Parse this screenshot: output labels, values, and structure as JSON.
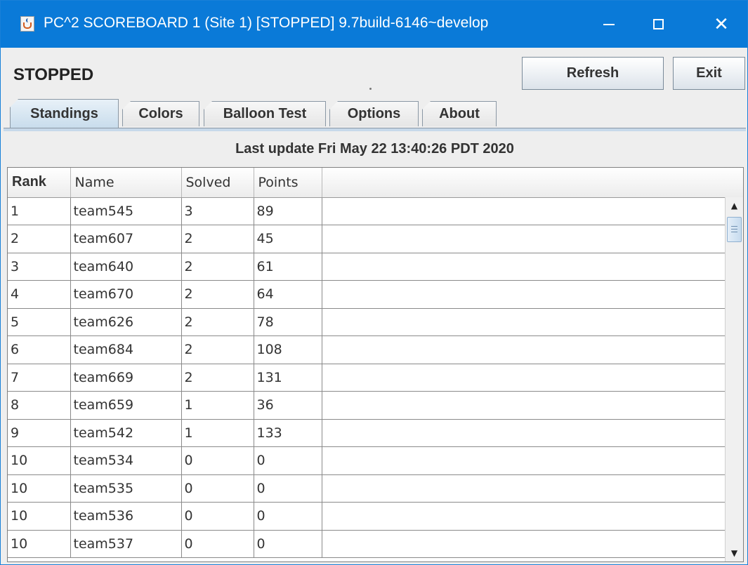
{
  "window": {
    "title": "PC^2 SCOREBOARD 1 (Site 1) [STOPPED] 9.7build-6146~develop",
    "controls": {
      "minimize": "—",
      "maximize": "☐",
      "close": "✕"
    }
  },
  "header": {
    "status": "STOPPED",
    "refresh_label": "Refresh",
    "exit_label": "Exit"
  },
  "tabs": [
    {
      "label": "Standings",
      "active": true
    },
    {
      "label": "Colors",
      "active": false
    },
    {
      "label": "Balloon Test",
      "active": false
    },
    {
      "label": "Options",
      "active": false
    },
    {
      "label": "About",
      "active": false
    }
  ],
  "standings": {
    "last_update": "Last update Fri May 22 13:40:26 PDT 2020",
    "columns": [
      "Rank",
      "Name",
      "Solved",
      "Points"
    ],
    "rows": [
      {
        "rank": "1",
        "name": "team545",
        "solved": "3",
        "points": "89"
      },
      {
        "rank": "2",
        "name": "team607",
        "solved": "2",
        "points": "45"
      },
      {
        "rank": "3",
        "name": "team640",
        "solved": "2",
        "points": "61"
      },
      {
        "rank": "4",
        "name": "team670",
        "solved": "2",
        "points": "64"
      },
      {
        "rank": "5",
        "name": "team626",
        "solved": "2",
        "points": "78"
      },
      {
        "rank": "6",
        "name": "team684",
        "solved": "2",
        "points": "108"
      },
      {
        "rank": "7",
        "name": "team669",
        "solved": "2",
        "points": "131"
      },
      {
        "rank": "8",
        "name": "team659",
        "solved": "1",
        "points": "36"
      },
      {
        "rank": "9",
        "name": "team542",
        "solved": "1",
        "points": "133"
      },
      {
        "rank": "10",
        "name": "team534",
        "solved": "0",
        "points": "0"
      },
      {
        "rank": "10",
        "name": "team535",
        "solved": "0",
        "points": "0"
      },
      {
        "rank": "10",
        "name": "team536",
        "solved": "0",
        "points": "0"
      },
      {
        "rank": "10",
        "name": "team537",
        "solved": "0",
        "points": "0"
      }
    ]
  },
  "scrollbar": {
    "up_icon": "▲",
    "down_icon": "▼"
  },
  "colors": {
    "titlebar": "#0a7ad8",
    "active_tab": "#c8dcec",
    "window_bg": "#eeeeee"
  }
}
